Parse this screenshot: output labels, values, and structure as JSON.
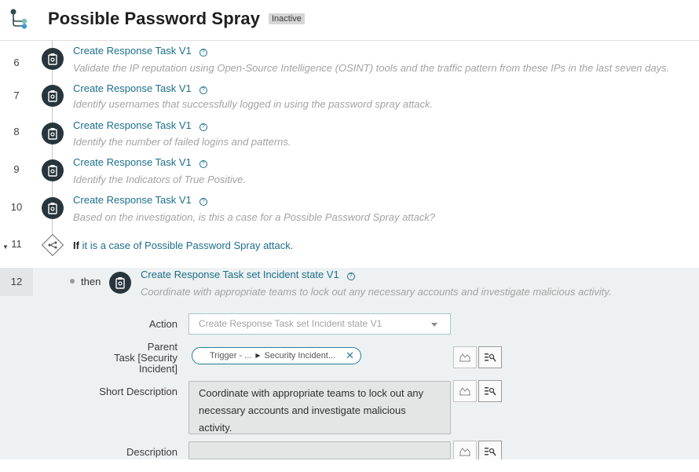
{
  "header": {
    "title": "Possible Password Spray",
    "status": "Inactive"
  },
  "steps": [
    {
      "num": "6",
      "title": "Create Response Task V1",
      "desc": "Validate the IP reputation using Open-Source Intelligence (OSINT) tools and the traffic pattern from these IPs in the last seven days."
    },
    {
      "num": "7",
      "title": "Create Response Task V1",
      "desc": "Identify usernames that successfully logged in using the password spray attack."
    },
    {
      "num": "8",
      "title": "Create Response Task V1",
      "desc": "Identify the number of failed logins and patterns."
    },
    {
      "num": "9",
      "title": "Create Response Task V1",
      "desc": "Identify the Indicators of True Positive."
    },
    {
      "num": "10",
      "title": "Create Response Task V1",
      "desc": "Based on the investigation, is this a case for a Possible Password Spray attack?"
    }
  ],
  "condition": {
    "num": "11",
    "if_label": "If",
    "expression": "it is a case of Possible Password Spray attack."
  },
  "branch_step": {
    "num": "12",
    "then_label": "then",
    "title": "Create Response Task set Incident state V1",
    "desc": "Coordinate with appropriate teams to lock out any necessary accounts and investigate malicious activity."
  },
  "form": {
    "action_label": "Action",
    "action_value": "Create Response Task set Incident state V1",
    "parent_label_line1": "Parent",
    "parent_label_line2": "Task [Security",
    "parent_label_line3": "Incident]",
    "parent_pill_part1": "Trigger - ...",
    "parent_pill_part2": "Security Incident...",
    "short_desc_label": "Short Description",
    "short_desc_value": "Coordinate with appropriate teams to lock out any necessary accounts and investigate malicious activity.",
    "description_label": "Description"
  },
  "colors": {
    "accent": "#1c6f8c",
    "step_icon_bg": "#28363c",
    "expanded_bg": "#eef1f1"
  }
}
